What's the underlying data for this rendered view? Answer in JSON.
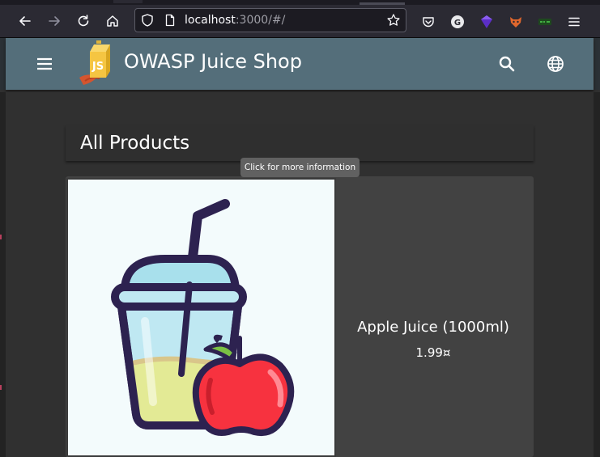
{
  "browser": {
    "url_host": "localhost",
    "url_path": ":3000/#/",
    "icons": [
      "back-icon",
      "forward-icon",
      "reload-icon",
      "home-icon",
      "shield-icon",
      "page-icon",
      "bookmark-star-icon",
      "pocket-icon",
      "g-extension-icon",
      "purple-extension-icon",
      "fox-extension-icon",
      "green-extension-icon",
      "menu-icon"
    ],
    "ext_g_label": "G"
  },
  "app": {
    "title": "OWASP Juice Shop",
    "logo_label": "JS",
    "bar_color": "#546e7a"
  },
  "main": {
    "heading": "All Products",
    "tooltip": "Click for more information",
    "products": [
      {
        "name": "Apple Juice (1000ml)",
        "price": "1.99¤"
      }
    ]
  }
}
